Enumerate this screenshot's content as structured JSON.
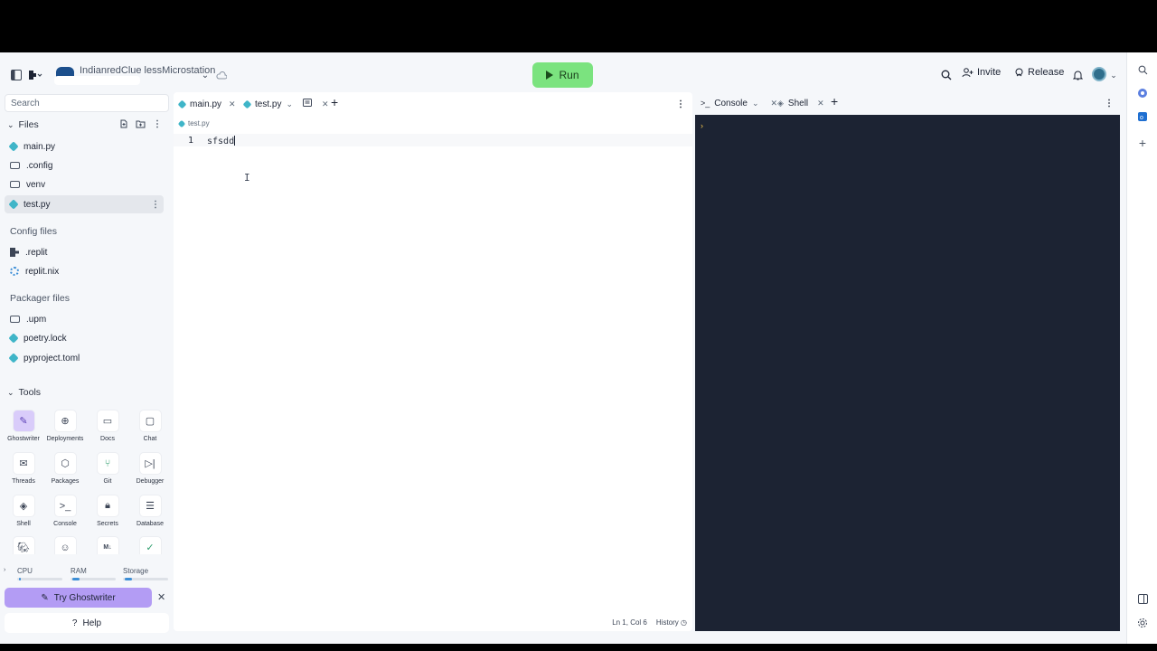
{
  "header": {
    "app_name": "IndianredClue lessMicrostation",
    "run_label": "Run",
    "invite_label": "Invite",
    "release_label": "Release"
  },
  "sidebar": {
    "search_placeholder": "Search",
    "files_title": "Files",
    "files": [
      {
        "name": "main.py",
        "icon": "python-icon"
      },
      {
        "name": ".config",
        "icon": "folder-icon"
      },
      {
        "name": "venv",
        "icon": "folder-icon"
      },
      {
        "name": "test.py",
        "icon": "python-icon"
      }
    ],
    "config_title": "Config files",
    "config_files": [
      ".replit",
      "replit.nix"
    ],
    "packager_title": "Packager files",
    "packager_files": [
      ".upm",
      "poetry.lock",
      "pyproject.toml"
    ],
    "tools_title": "Tools",
    "tools": [
      "Ghostwriter",
      "Deployments",
      "Docs",
      "Chat",
      "Threads",
      "Packages",
      "Git",
      "Debugger",
      "Shell",
      "Console",
      "Secrets",
      "Database"
    ],
    "usage": {
      "cpu": "CPU",
      "ram": "RAM",
      "storage": "Storage",
      "cpu_level": 0.02,
      "ram_level": 0.15,
      "storage_level": 0.15
    },
    "ghost_label": "Try Ghostwriter",
    "help_label": "Help"
  },
  "editor": {
    "tabs": [
      "main.py",
      "test.py"
    ],
    "breadcrumb": "test.py",
    "line_number": "1",
    "code_line": "sfsdd",
    "status_pos": "Ln 1, Col 6",
    "history_label": "History"
  },
  "console": {
    "tabs": [
      "Console",
      "Shell"
    ],
    "prompt": "›"
  },
  "colors": {
    "run": "#7be37f",
    "console_bg": "#1c2333",
    "ghostwriter": "#b39cf4"
  }
}
